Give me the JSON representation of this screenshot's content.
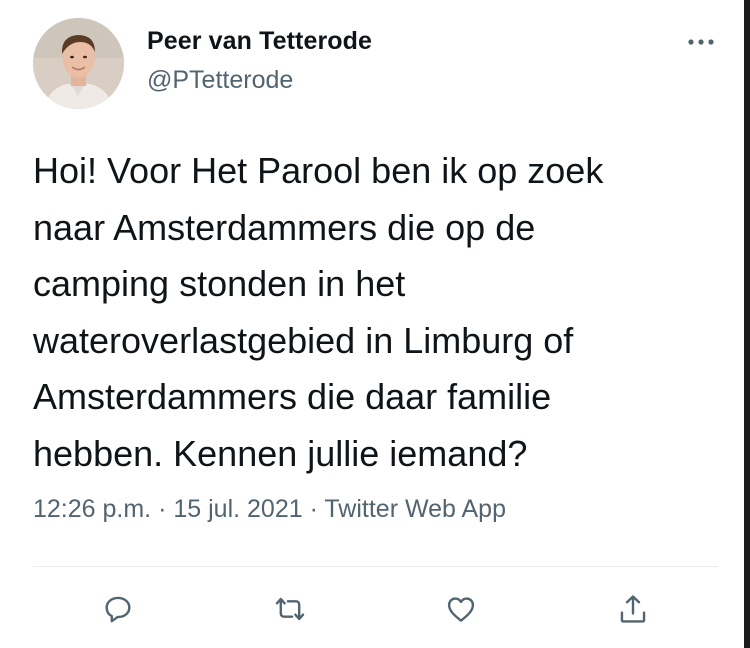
{
  "user": {
    "display_name": "Peer van Tetterode",
    "handle": "@PTetterode"
  },
  "tweet": {
    "lines": [
      "Hoi! Voor Het Parool ben ik op zoek",
      "naar Amsterdammers die op de",
      "camping stonden in het",
      "wateroverlastgebied in Limburg of",
      "Amsterdammers die daar familie",
      "hebben. Kennen jullie iemand?"
    ],
    "time": "12:26 p.m.",
    "separator": " · ",
    "date": "15 jul. 2021",
    "source": "Twitter Web App"
  },
  "icons": {
    "more": "more-dots-icon",
    "reply": "reply-icon",
    "retweet": "retweet-icon",
    "like": "like-icon",
    "share": "share-icon"
  },
  "colors": {
    "text": "#0f1419",
    "secondary": "#536471",
    "divider": "#e6ecf0"
  }
}
